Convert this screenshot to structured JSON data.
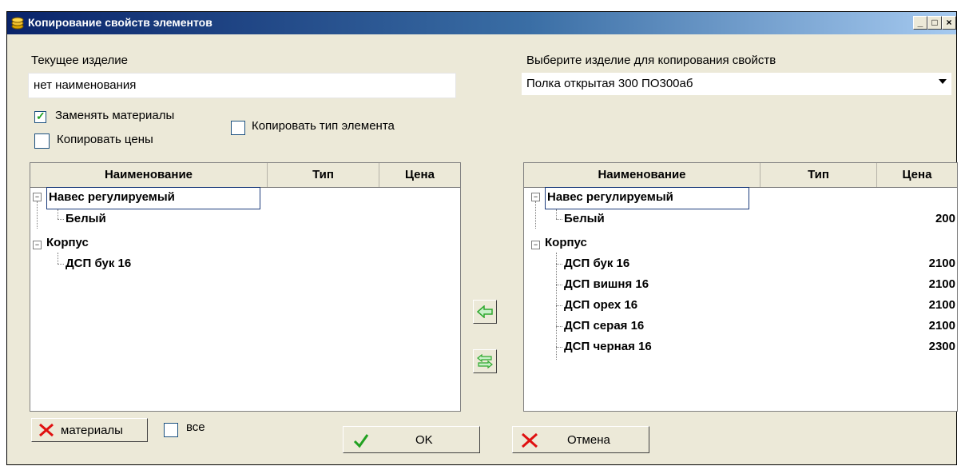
{
  "window": {
    "title": "Копирование свойств элементов",
    "min": "_",
    "max": "□",
    "close": "×"
  },
  "current": {
    "label": "Текущее изделие",
    "value": "нет наименования"
  },
  "target": {
    "label": "Выберите изделие для копирования свойств",
    "value": "Полка открытая 300 ПО300аб"
  },
  "options": {
    "replace_materials": {
      "label": "Заменять материалы",
      "checked": true
    },
    "copy_prices": {
      "label": "Копировать цены",
      "checked": false
    },
    "copy_type": {
      "label": "Копировать тип элемента",
      "checked": false
    }
  },
  "columns": [
    "Наименование",
    "Тип",
    "Цена"
  ],
  "left_tree": [
    {
      "name": "Навес регулируемый",
      "children": [
        {
          "name": "Белый"
        }
      ]
    },
    {
      "name": "Корпус",
      "children": [
        {
          "name": "ДСП бук 16"
        }
      ]
    }
  ],
  "right_tree": [
    {
      "name": "Навес регулируемый",
      "children": [
        {
          "name": "Белый",
          "price": "200"
        }
      ]
    },
    {
      "name": "Корпус",
      "children": [
        {
          "name": "ДСП бук 16",
          "price": "2100"
        },
        {
          "name": "ДСП вишня 16",
          "price": "2100"
        },
        {
          "name": "ДСП орех 16",
          "price": "2100"
        },
        {
          "name": "ДСП серая 16",
          "price": "2100"
        },
        {
          "name": "ДСП черная 16",
          "price": "2300"
        }
      ]
    }
  ],
  "bottom": {
    "materials_btn": "материалы",
    "all_label": "все",
    "all_checked": false,
    "ok": "OK",
    "cancel": "Отмена"
  },
  "colors": {
    "title_start": "#0a246a",
    "title_end": "#a6caf0",
    "window_bg": "#ece9d8",
    "ok_check": "#21a121",
    "cancel_x": "#e01010",
    "arrow_green": "#2fa82f"
  }
}
